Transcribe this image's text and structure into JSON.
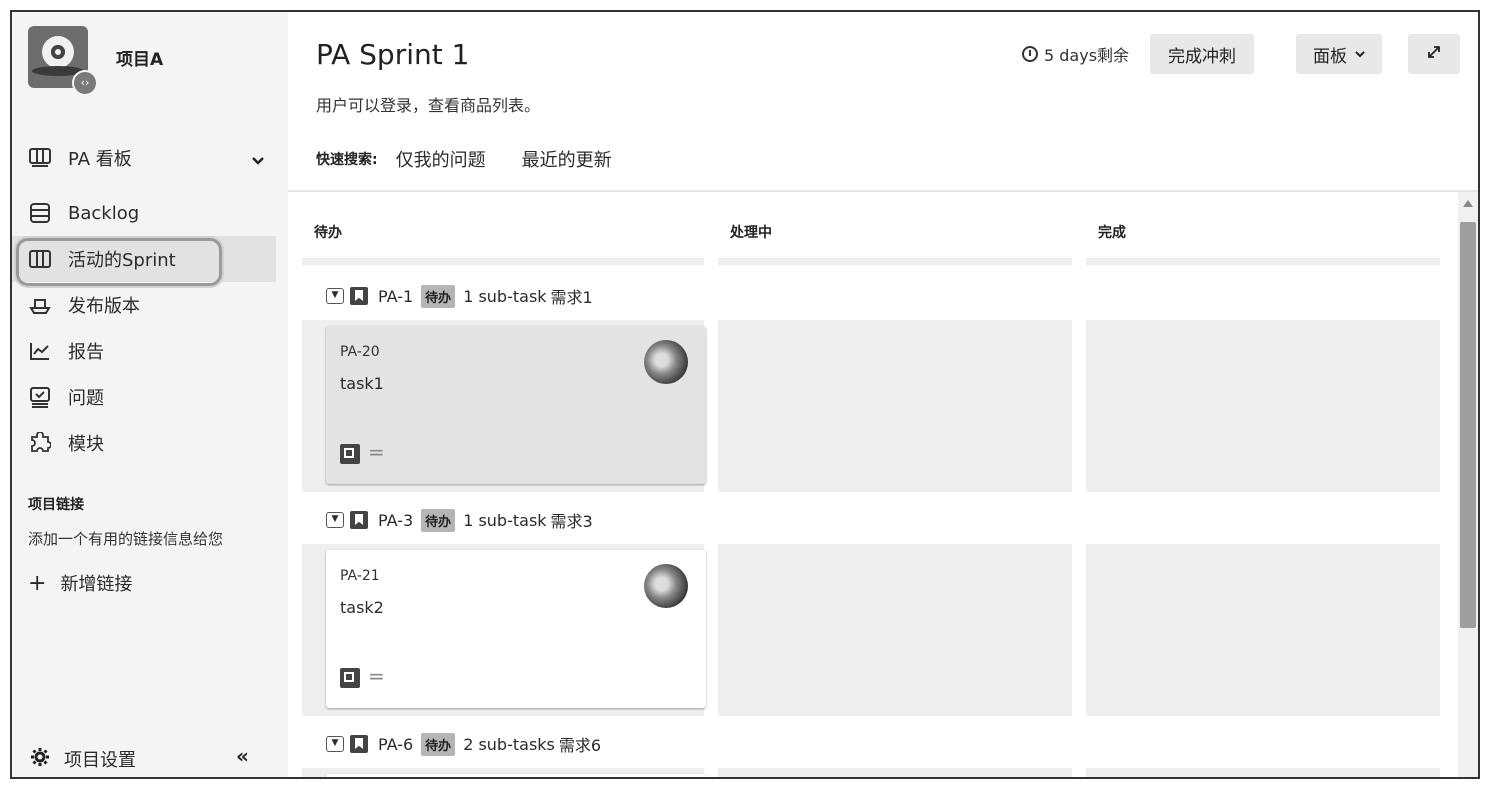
{
  "project": {
    "name": "项目A",
    "avatar_badge": "‹›"
  },
  "sidebar": {
    "board_selector": {
      "label": "PA 看板"
    },
    "items": [
      {
        "label": "Backlog",
        "icon": "backlog-icon"
      },
      {
        "label": "活动的Sprint",
        "icon": "board-icon",
        "active": true
      },
      {
        "label": "发布版本",
        "icon": "ship-icon"
      },
      {
        "label": "报告",
        "icon": "chart-icon"
      },
      {
        "label": "问题",
        "icon": "issues-icon"
      },
      {
        "label": "模块",
        "icon": "puzzle-icon"
      }
    ],
    "links_title": "项目链接",
    "links_desc": "添加一个有用的链接信息给您",
    "add_link": "新增链接",
    "settings": "项目设置"
  },
  "header": {
    "title": "PA Sprint 1",
    "description": "用户可以登录，查看商品列表。",
    "remaining": "5 days剩余",
    "complete_button": "完成冲刺",
    "board_button": "面板",
    "quick_filter_label": "快速搜索:",
    "quick_filters": [
      "仅我的问题",
      "最近的更新"
    ]
  },
  "columns": [
    "待办",
    "处理中",
    "完成"
  ],
  "swimlanes": [
    {
      "key": "PA-1",
      "status": "待办",
      "subtasks": "1 sub-task",
      "title": "需求1",
      "card": {
        "key": "PA-20",
        "summary": "task1"
      }
    },
    {
      "key": "PA-3",
      "status": "待办",
      "subtasks": "1 sub-task",
      "title": "需求3",
      "card": {
        "key": "PA-21",
        "summary": "task2"
      }
    },
    {
      "key": "PA-6",
      "status": "待办",
      "subtasks": "2 sub-tasks",
      "title": "需求6"
    }
  ]
}
